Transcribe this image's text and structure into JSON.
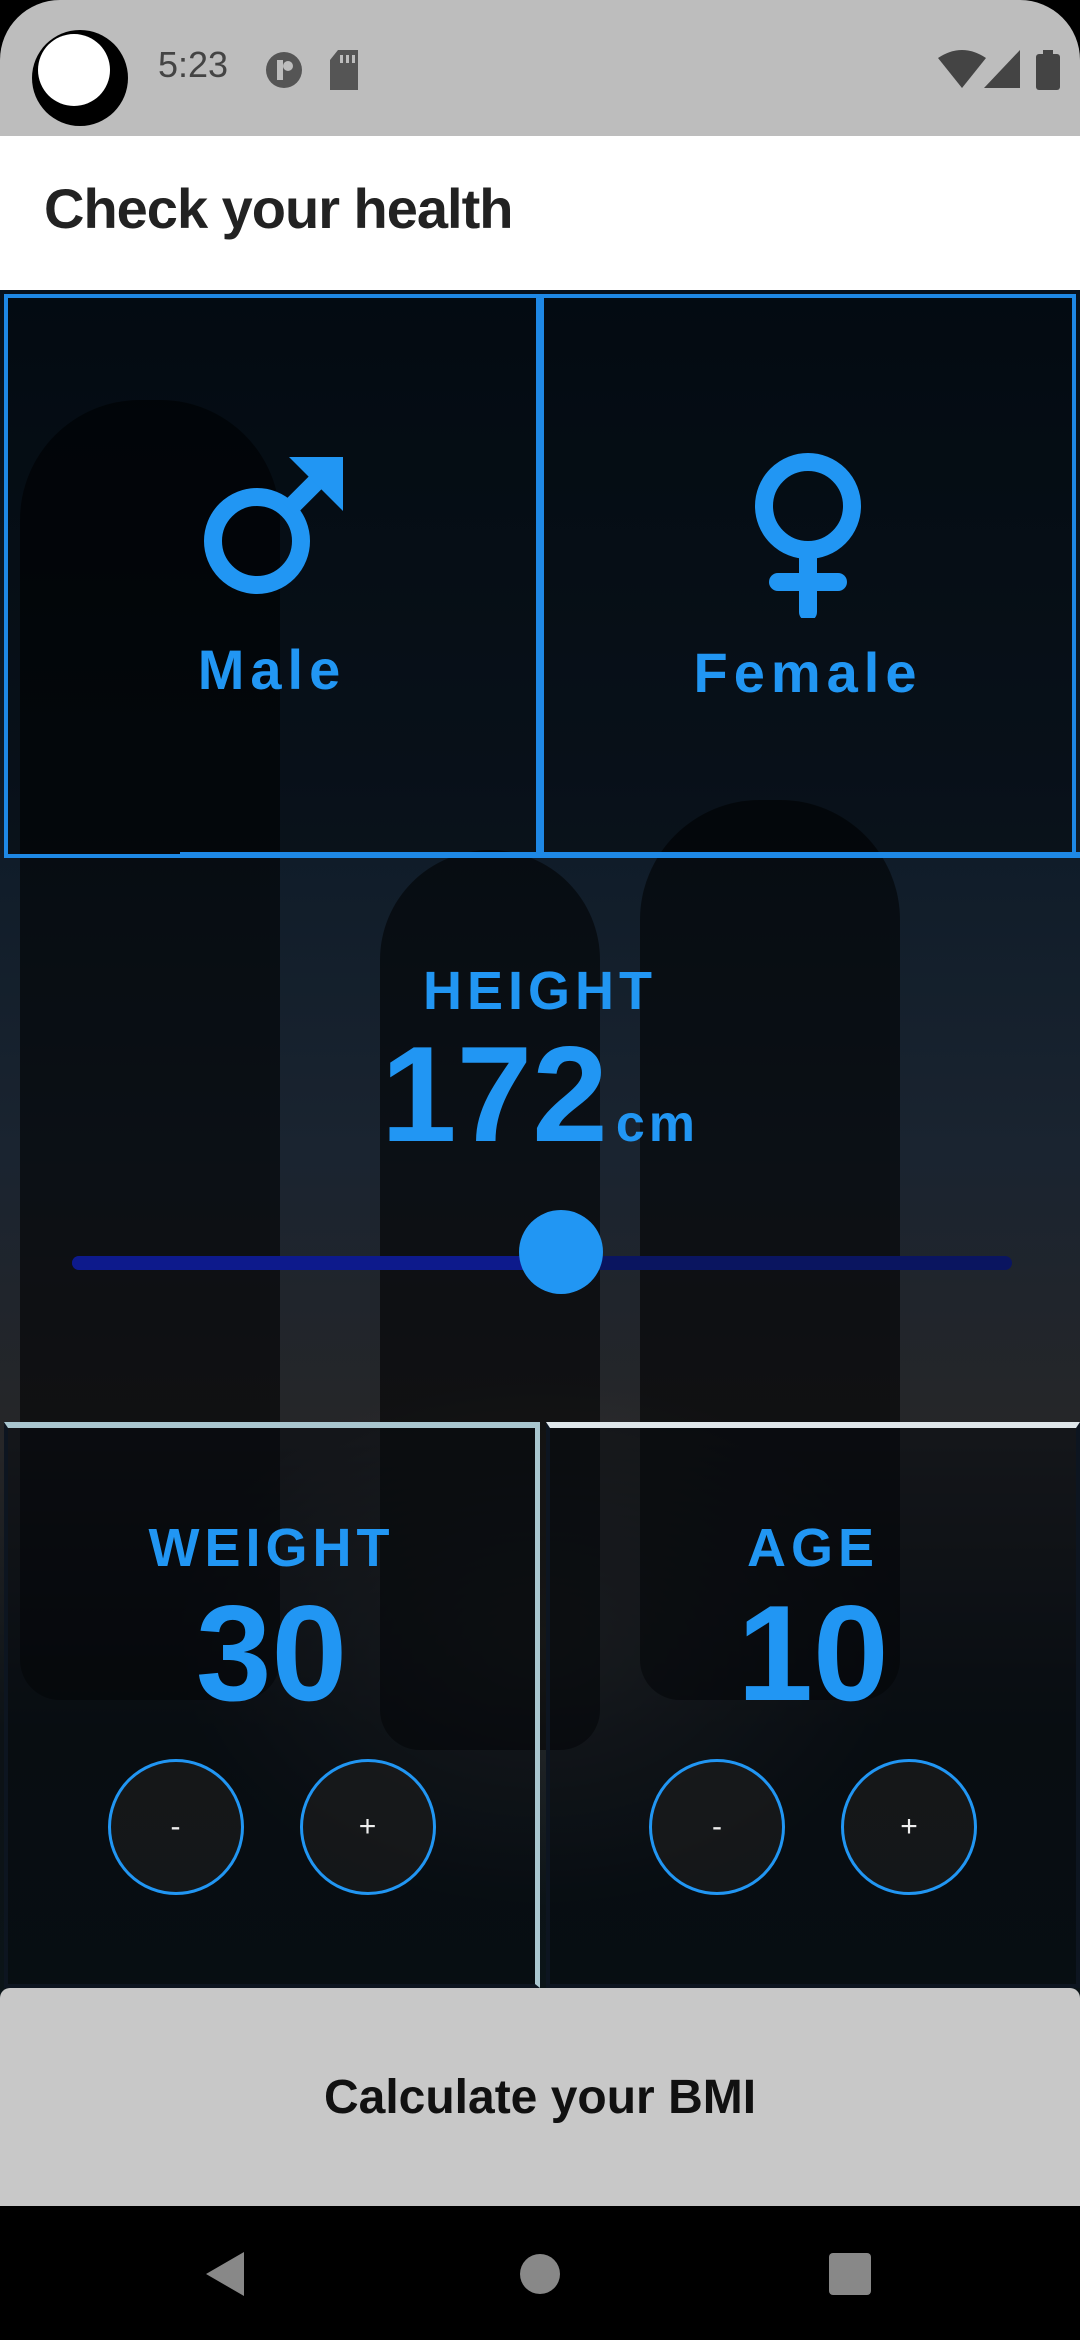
{
  "status_bar": {
    "time": "5:23",
    "icons_left": [
      "moon-avatar-icon",
      "notification-icon",
      "sd-card-icon"
    ],
    "icons_right": [
      "wifi-icon",
      "signal-icon",
      "battery-icon"
    ]
  },
  "app_bar": {
    "title": "Check your health"
  },
  "gender": {
    "male": {
      "label": "Male",
      "icon": "male-symbol-icon"
    },
    "female": {
      "label": "Female",
      "icon": "female-symbol-icon"
    }
  },
  "height": {
    "label": "HEIGHT",
    "value": "172",
    "unit": "cm",
    "slider_fraction": 0.52
  },
  "weight": {
    "label": "WEIGHT",
    "value": "30",
    "decrement": "-",
    "increment": "+"
  },
  "age": {
    "label": "AGE",
    "value": "10",
    "decrement": "-",
    "increment": "+"
  },
  "calculate_button": {
    "label": "Calculate your BMI"
  },
  "colors": {
    "accent": "#2196f3",
    "status_bar": "#bdbdbd",
    "button": "#c8c8c8"
  }
}
